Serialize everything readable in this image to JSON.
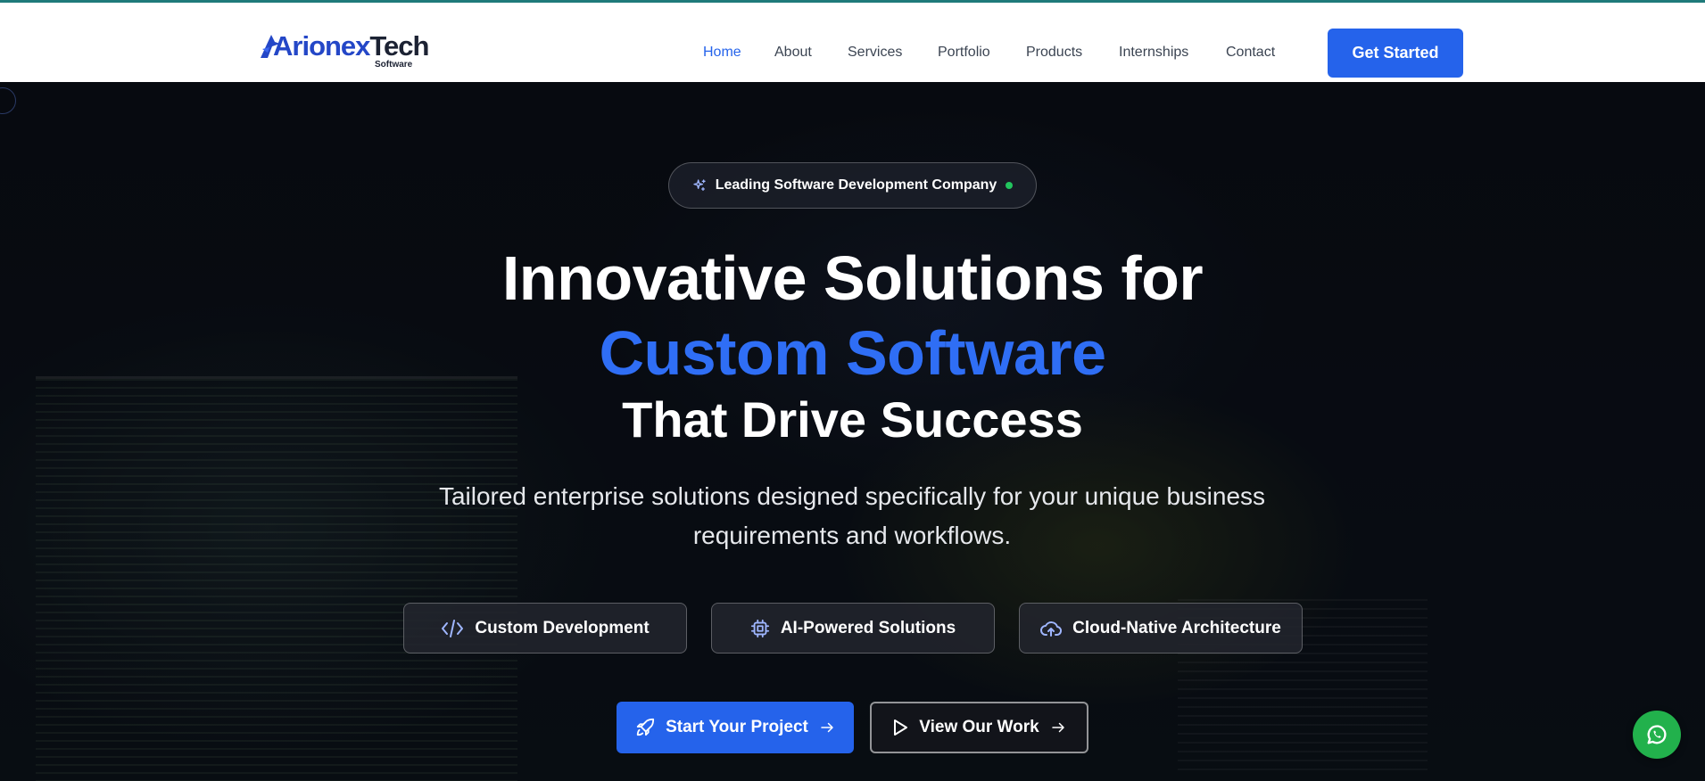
{
  "brand": {
    "logo_part1": "Arionex",
    "logo_part2": "Tech",
    "logo_sub": "Software",
    "accent_color": "#2563eb",
    "icon": "logo-mark-icon"
  },
  "nav": {
    "items": [
      {
        "label": "Home",
        "active": true
      },
      {
        "label": "About"
      },
      {
        "label": "Services"
      },
      {
        "label": "Portfolio"
      },
      {
        "label": "Products"
      },
      {
        "label": "Internships"
      },
      {
        "label": "Contact"
      }
    ],
    "cta_label": "Get Started"
  },
  "hero": {
    "badge_text": "Leading Software Development Company",
    "badge_icon": "sparkles-icon",
    "badge_status_color": "#22c55e",
    "title_line1": "Innovative Solutions for",
    "title_line2": "Custom Software",
    "title_line3": "That Drive Success",
    "subtitle_line1": "Tailored enterprise solutions designed specifically for your unique business",
    "subtitle_line2": "requirements and workflows.",
    "features": [
      {
        "label": "Custom Development",
        "icon": "code-icon"
      },
      {
        "label": "AI-Powered Solutions",
        "icon": "cpu-chip-icon"
      },
      {
        "label": "Cloud-Native Architecture",
        "icon": "cloud-upload-icon"
      }
    ],
    "primary_cta": {
      "label": "Start Your Project",
      "icon": "rocket-icon"
    },
    "secondary_cta": {
      "label": "View Our Work",
      "icon": "play-icon"
    }
  },
  "floating": {
    "whatsapp_icon": "whatsapp-icon",
    "whatsapp_color": "#22b14c"
  }
}
